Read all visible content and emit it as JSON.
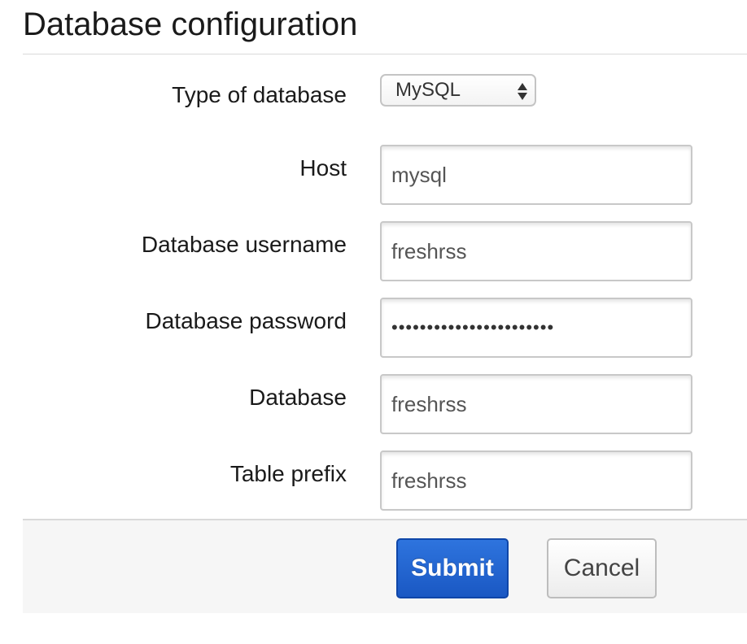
{
  "page_title": "Database configuration",
  "fields": {
    "db_type": {
      "label": "Type of database",
      "value": "MySQL"
    },
    "host": {
      "label": "Host",
      "value": "mysql"
    },
    "username": {
      "label": "Database username",
      "value": "freshrss"
    },
    "password": {
      "label": "Database password",
      "value": "•••••••••••••••••••••••"
    },
    "database": {
      "label": "Database",
      "value": "freshrss"
    },
    "prefix": {
      "label": "Table prefix",
      "value": "freshrss"
    }
  },
  "actions": {
    "submit_label": "Submit",
    "cancel_label": "Cancel"
  },
  "colors": {
    "submit_bg": "#1f62cf",
    "footer_bg": "#f6f6f6"
  }
}
